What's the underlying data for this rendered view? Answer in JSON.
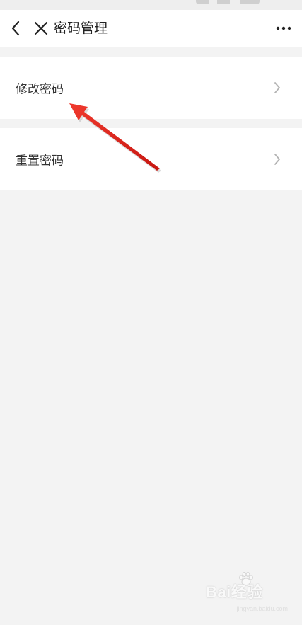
{
  "header": {
    "title": "密码管理",
    "back_icon": "chevron-left-icon",
    "close_icon": "close-icon",
    "more_icon": "more-horizontal-icon"
  },
  "menu": {
    "items": [
      {
        "label": "修改密码",
        "icon": "chevron-right-icon"
      },
      {
        "label": "重置密码",
        "icon": "chevron-right-icon"
      }
    ]
  },
  "watermark": {
    "brand": "Bai经验",
    "domain": "jingyan.baidu.com"
  },
  "colors": {
    "background": "#f3f3f3",
    "surface": "#ffffff",
    "text": "#333333",
    "chevron": "#b3b3b3",
    "annotation_arrow": "#e0221b"
  }
}
